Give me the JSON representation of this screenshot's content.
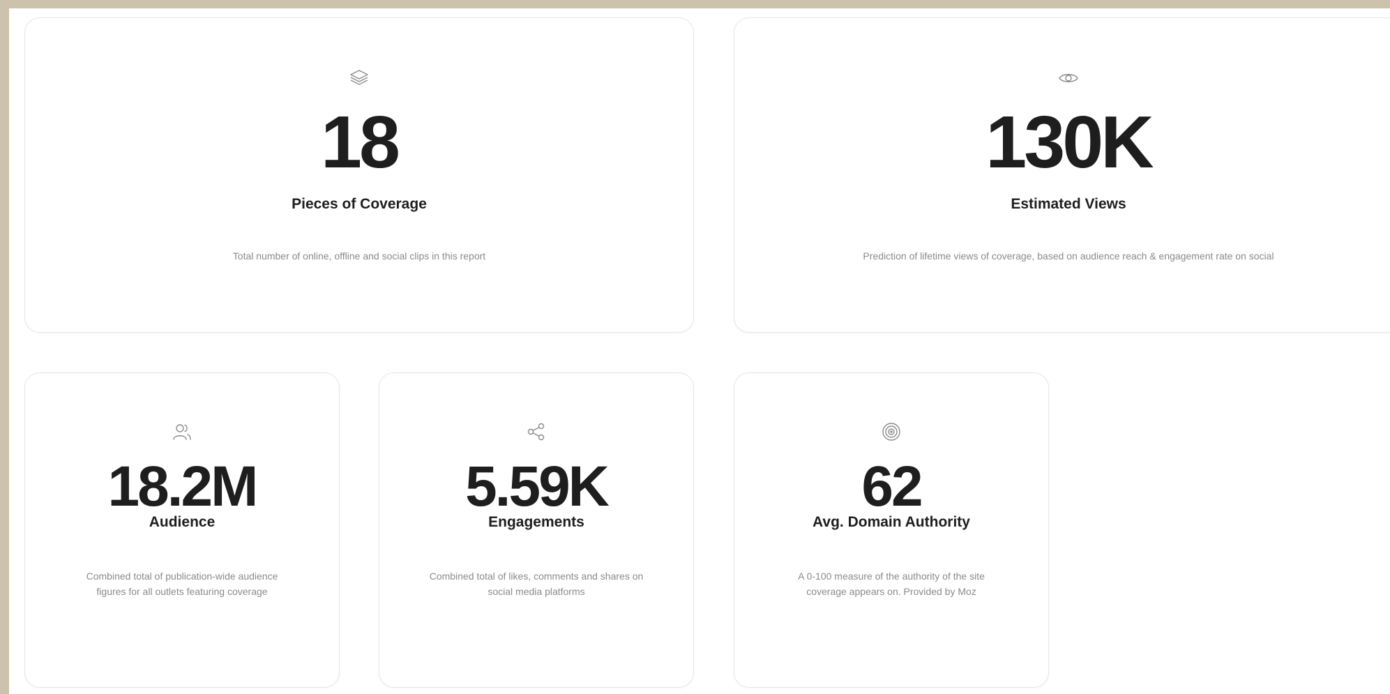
{
  "cards": [
    {
      "icon": "layers-icon",
      "value": "18",
      "label": "Pieces of Coverage",
      "description": "Total number of online, offline and social clips in this report"
    },
    {
      "icon": "eye-icon",
      "value": "130K",
      "label": "Estimated Views",
      "description": "Prediction of lifetime views of coverage, based on audience reach & engagement rate on social"
    },
    {
      "icon": "users-icon",
      "value": "18.2M",
      "label": "Audience",
      "description": "Combined total of publication-wide audience figures for all outlets featuring coverage"
    },
    {
      "icon": "share-icon",
      "value": "5.59K",
      "label": "Engagements",
      "description": "Combined total of likes, comments and shares on social media platforms"
    },
    {
      "icon": "target-icon",
      "value": "62",
      "label": "Avg. Domain Authority",
      "description": "A 0-100 measure of the authority of the site coverage appears on. Provided by Moz"
    }
  ],
  "colors": {
    "frame": "#cdc3ad",
    "card_border": "#e6e6e6",
    "value_text": "#1e1e1e",
    "muted_text": "#8a8a8a"
  }
}
